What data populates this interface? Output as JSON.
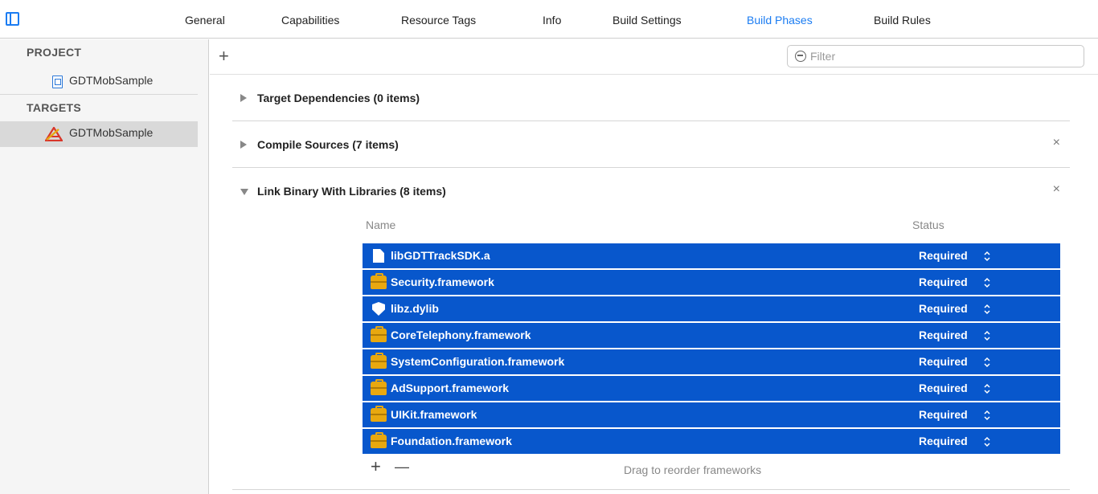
{
  "tabs": [
    {
      "label": "General",
      "active": false
    },
    {
      "label": "Capabilities",
      "active": false
    },
    {
      "label": "Resource Tags",
      "active": false
    },
    {
      "label": "Info",
      "active": false
    },
    {
      "label": "Build Settings",
      "active": false
    },
    {
      "label": "Build Phases",
      "active": true
    },
    {
      "label": "Build Rules",
      "active": false
    }
  ],
  "sidebar": {
    "project_header": "PROJECT",
    "project_item": "GDTMobSample",
    "targets_header": "TARGETS",
    "target_item": "GDTMobSample"
  },
  "toolbar": {
    "add_symbol": "+",
    "filter_placeholder": "Filter"
  },
  "phases": [
    {
      "title": "Target Dependencies (0 items)",
      "expanded": false,
      "closable": false
    },
    {
      "title": "Compile Sources (7 items)",
      "expanded": false,
      "closable": true
    },
    {
      "title": "Link Binary With Libraries (8 items)",
      "expanded": true,
      "closable": true
    }
  ],
  "close_symbol": "×",
  "libraries": {
    "columns": [
      "Name",
      "Status"
    ],
    "rows": [
      {
        "name": "libGDTTrackSDK.a",
        "status": "Required",
        "icon": "file-icon"
      },
      {
        "name": "Security.framework",
        "status": "Required",
        "icon": "framework-icon"
      },
      {
        "name": "libz.dylib",
        "status": "Required",
        "icon": "dylib-shield-icon"
      },
      {
        "name": "CoreTelephony.framework",
        "status": "Required",
        "icon": "framework-icon"
      },
      {
        "name": "SystemConfiguration.framework",
        "status": "Required",
        "icon": "framework-icon"
      },
      {
        "name": "AdSupport.framework",
        "status": "Required",
        "icon": "framework-icon"
      },
      {
        "name": "UIKit.framework",
        "status": "Required",
        "icon": "framework-icon"
      },
      {
        "name": "Foundation.framework",
        "status": "Required",
        "icon": "framework-icon"
      }
    ],
    "add_symbol": "+",
    "remove_symbol": "—",
    "drag_hint": "Drag to reorder frameworks"
  },
  "colors": {
    "accent": "#1b7cf2",
    "selection": "#0857cc",
    "framework": "#e8a80f"
  }
}
